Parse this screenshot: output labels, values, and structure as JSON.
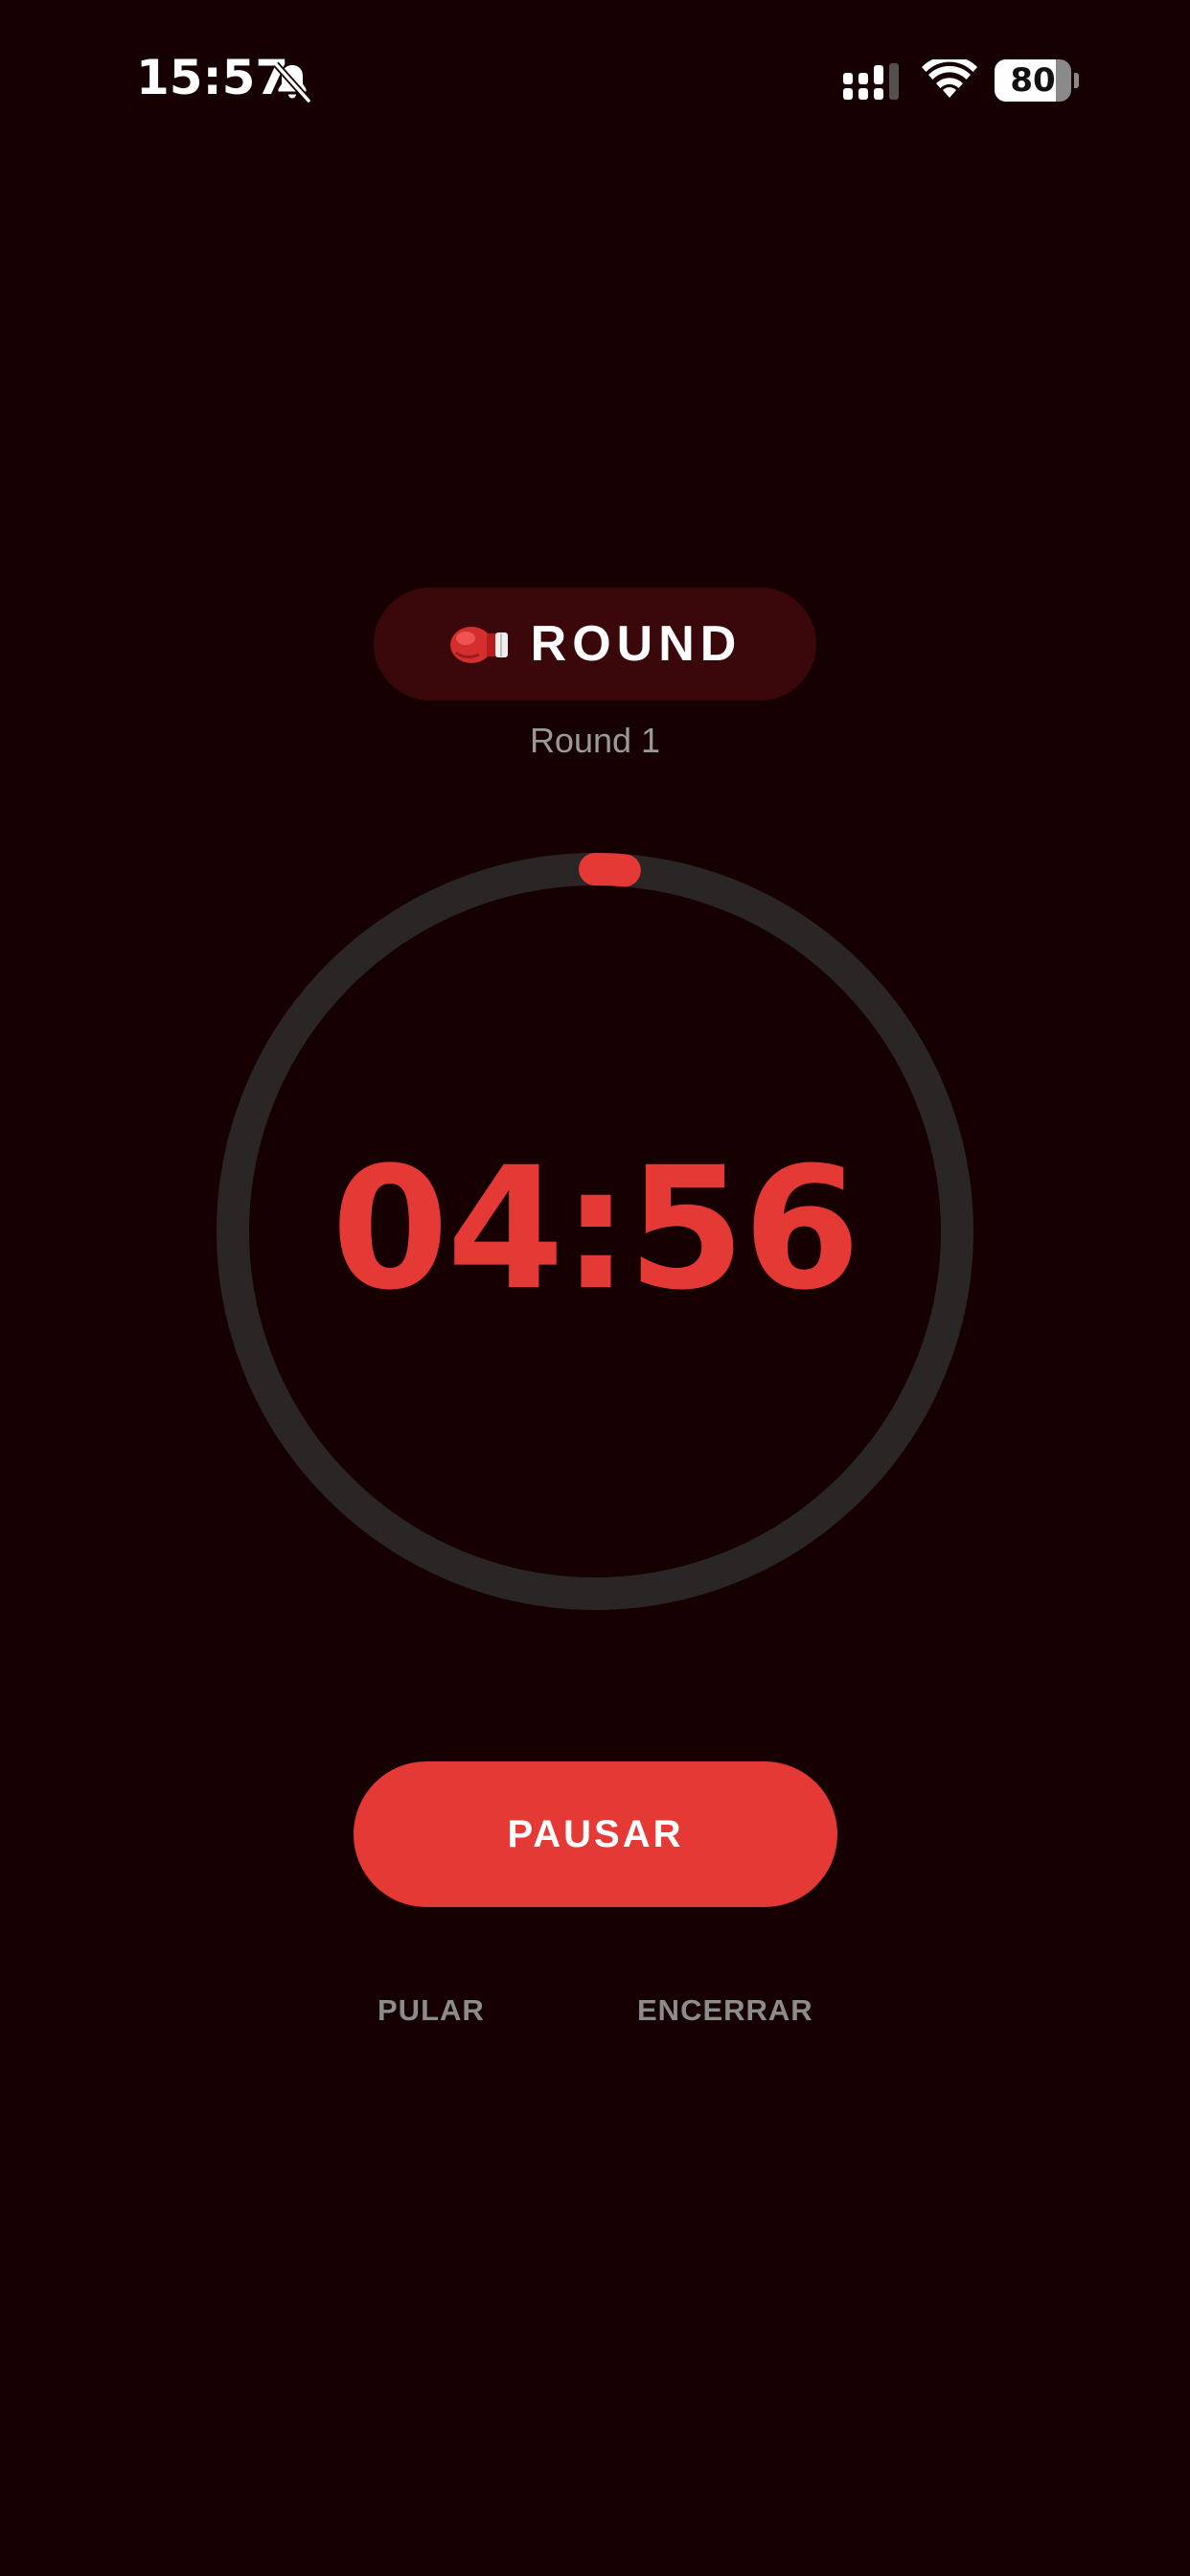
{
  "status_bar": {
    "time": "15:57",
    "battery": "80",
    "battery_level": 0.8,
    "icons": [
      "bell-slash-icon",
      "signal-icon",
      "wifi-icon",
      "battery-icon"
    ]
  },
  "phase": {
    "icon": "boxing-glove-icon",
    "label": "ROUND"
  },
  "round_label": "Round 1",
  "timer": {
    "display": "04:56",
    "progress": 0.013
  },
  "controls": {
    "pause_label": "PAUSAR",
    "skip_label": "PULAR",
    "end_label": "ENCERRAR"
  },
  "colors": {
    "background": "#160002",
    "accent": "#e53935",
    "ring_track": "#2a2626",
    "pill_background": "#3a080b",
    "muted_text": "#9a9a9a"
  }
}
